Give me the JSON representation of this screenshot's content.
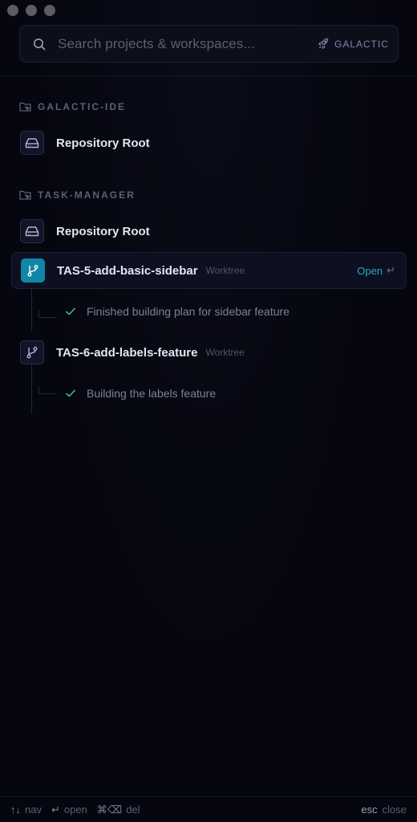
{
  "search": {
    "placeholder": "Search projects & workspaces...",
    "badge_label": "GALACTIC"
  },
  "groups": [
    {
      "name": "GALACTIC-IDE",
      "items": [
        {
          "label": "Repository Root"
        }
      ]
    },
    {
      "name": "TASK-MANAGER",
      "items": [
        {
          "label": "Repository Root"
        },
        {
          "label": "TAS-5-add-basic-sidebar",
          "tag": "Worktree",
          "action": "Open",
          "status": "Finished building plan for sidebar feature"
        },
        {
          "label": "TAS-6-add-labels-feature",
          "tag": "Worktree",
          "status": "Building the labels feature"
        }
      ]
    }
  ],
  "footer": {
    "nav_key": "↑↓",
    "nav_label": "nav",
    "open_key": "↵",
    "open_label": "open",
    "del_key": "⌘⌫",
    "del_label": "del",
    "close_key": "esc",
    "close_label": "close"
  },
  "colors": {
    "accent": "#1187a7",
    "open_text": "#2ba6c3",
    "check": "#35c08e",
    "background": "#05060f"
  }
}
